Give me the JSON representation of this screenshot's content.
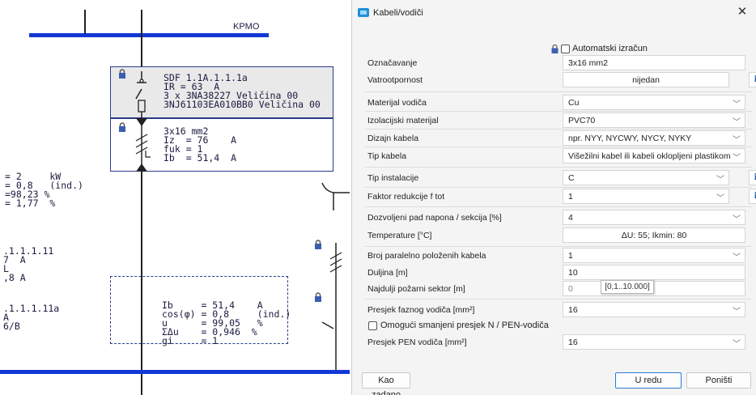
{
  "schematic": {
    "bus_label": "KPMO",
    "breaker_block": [
      "SDF 1.1A.1.1.1a",
      "IR = 63  A",
      "3 x 3NA38227 Veličina 00",
      "3NJ61103EA010BB0 Veličina 00"
    ],
    "cable_block": [
      "3x16 mm2",
      "Iz  = 76    A",
      "fuk = 1",
      "Ib  = 51,4  A"
    ],
    "left_block_1": [
      "= 2     kW",
      "= 0,8   (ind.)",
      "=98,23 %",
      "= 1,77  %"
    ],
    "left_block_2": [
      ".1.1.1.11",
      "7  A",
      "L",
      ",8 A"
    ],
    "left_block_3": [
      ".1.1.1.11a",
      "A",
      "6/B"
    ],
    "result_block": [
      "Ib     = 51,4    A",
      "cos(φ) = 0,8     (ind.)",
      "u      = 99,05   %",
      "ΣΔu    = 0,946  %",
      "gi     = 1"
    ]
  },
  "dialog": {
    "title": "Kabeli/vodiči",
    "auto_calc_label": "Automatski izračun",
    "fields": [
      {
        "label": "Označavanje",
        "value": "3x16 mm2"
      },
      {
        "label": "Vatrootpornost",
        "value": "nijedan"
      },
      {
        "label": "Materijal vodiča",
        "value": "Cu"
      },
      {
        "label": "Izolacijski materijal",
        "value": "PVC70"
      },
      {
        "label": "Dizajn kabela",
        "value": "npr. NYY, NYCWY, NYCY, NYKY"
      },
      {
        "label": "Tip kabela",
        "value": "Višežilni kabel ili kabeli oklopljeni plastikom"
      },
      {
        "label": "Tip instalacije",
        "value": "C"
      },
      {
        "label": "Faktor redukcije f tot",
        "value": "1"
      },
      {
        "label": "Dozvoljeni pad napona / sekcija [%]",
        "value": "4"
      },
      {
        "label": "Temperature [°C]",
        "value": "ΔU: 55; Ikmin: 80"
      },
      {
        "label": "Broj paralelno položenih kabela",
        "value": "1"
      },
      {
        "label": "Duljina [m]",
        "value": "10"
      },
      {
        "label": "Najdulji požarni sektor [m]",
        "value": "0"
      },
      {
        "label": "Presjek faznog vodiča  [mm²]",
        "value": "16"
      },
      {
        "label": "Presjek PEN vodiča [mm²]",
        "value": "16"
      }
    ],
    "info_icon_label": "i",
    "range_tooltip": "[0,1..10.000]",
    "reduced_section_label": "Omogući smanjeni presjek N / PEN-vodiča",
    "buttons": {
      "default": "Kao zadano",
      "ok": "U redu",
      "cancel": "Poništi"
    },
    "close_symbol": "✕",
    "chevron_symbol": "﹀"
  },
  "colors": {
    "busbar": "#1238d6",
    "accent": "#2a7ad8"
  },
  "icons": {
    "lock": "lock-icon",
    "app": "cable-app-icon",
    "info": "info-icon",
    "close": "close-icon",
    "dropdown": "chevron-down-icon"
  }
}
